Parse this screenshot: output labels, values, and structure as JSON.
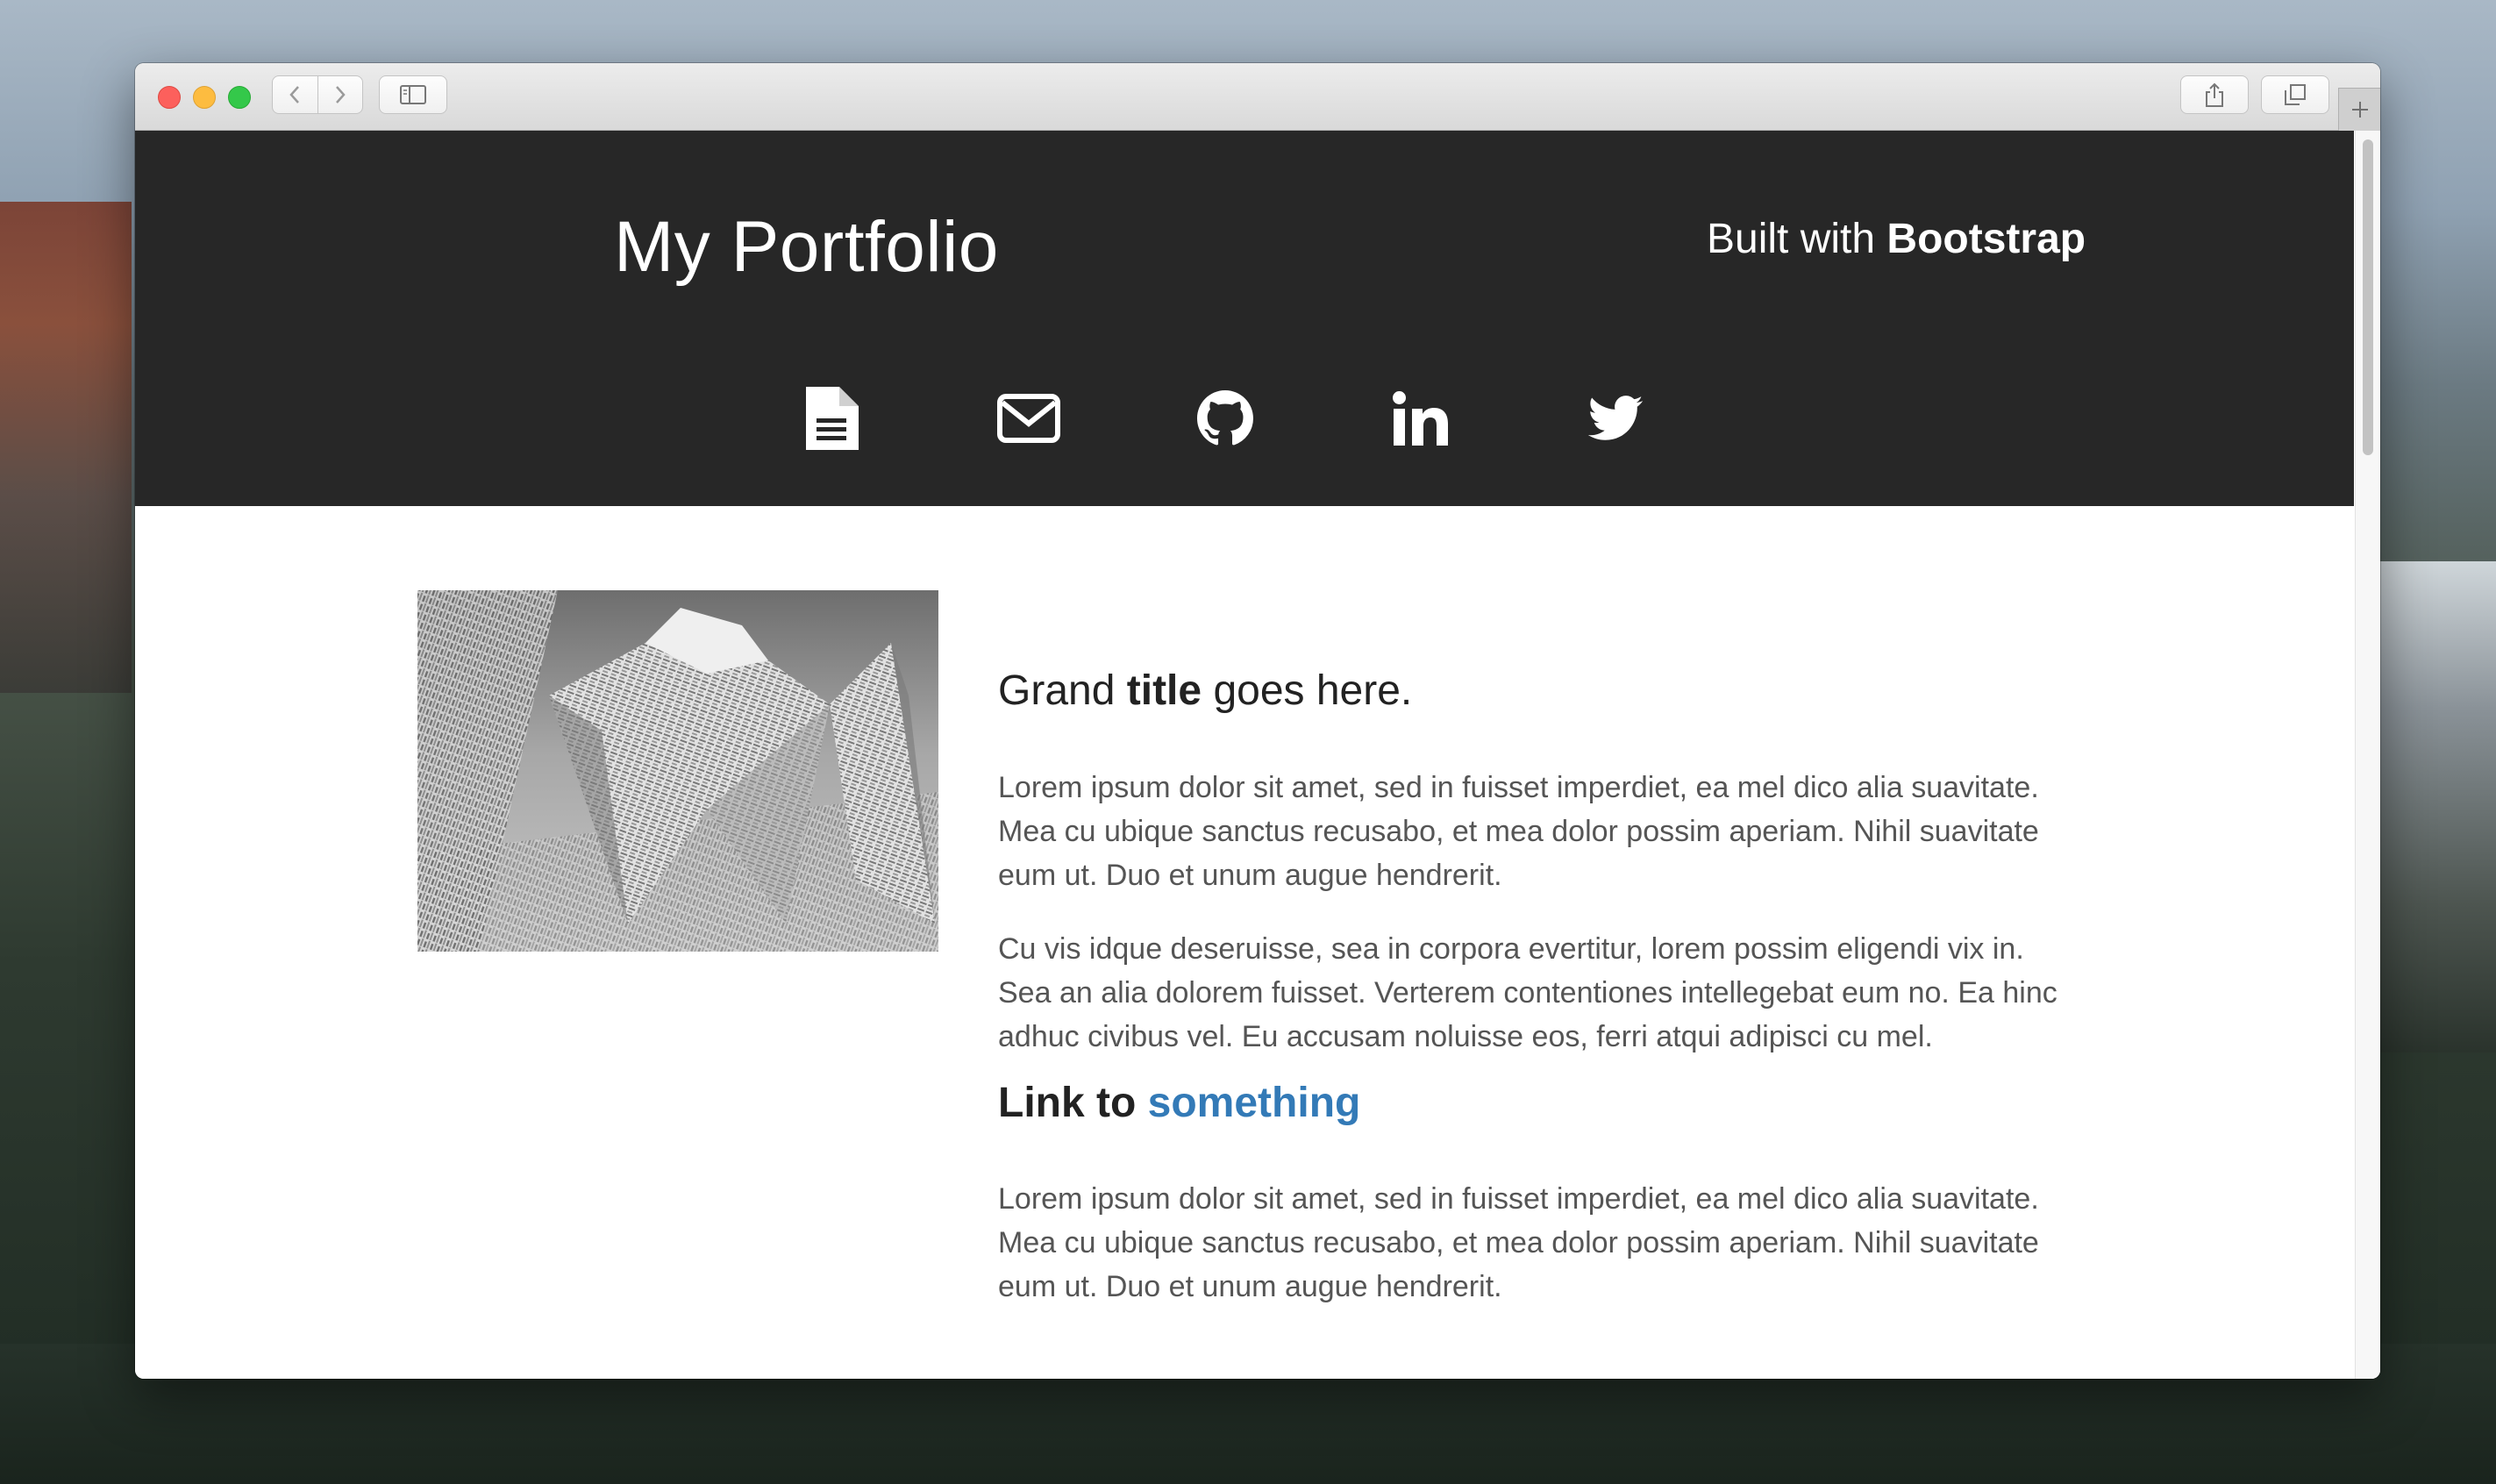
{
  "header": {
    "title": "My Portfolio",
    "built_prefix": "Built with",
    "built_brand": "Bootstrap",
    "social": [
      {
        "icon": "document-icon"
      },
      {
        "icon": "envelope-icon"
      },
      {
        "icon": "github-icon"
      },
      {
        "icon": "linkedin-icon"
      },
      {
        "icon": "twitter-icon"
      }
    ]
  },
  "article": {
    "title_start": "Grand",
    "title_bold": "title",
    "title_end": "goes here.",
    "paragraph1": "Lorem ipsum dolor sit amet, sed in fuisset imperdiet, ea mel dico alia suavitate. Mea cu ubique sanctus recusabo, et mea dolor possim aperiam. Nihil suavitate eum ut. Duo et unum augue hendrerit.",
    "paragraph2": "Cu vis idque deseruisse, sea in corpora evertitur, lorem possim eligendi vix in. Sea an alia dolorem fuisset. Verterem contentiones intellegebat eum no. Ea hinc adhuc civibus vel. Eu accusam noluisse eos, ferri atqui adipisci cu mel.",
    "link_prefix": "Link to",
    "link_text": "something",
    "paragraph3": "Lorem ipsum dolor sit amet, sed in fuisset imperdiet, ea mel dico alia suavitate. Mea cu ubique sanctus recusabo, et mea dolor possim aperiam. Nihil suavitate eum ut. Duo et unum augue hendrerit."
  },
  "colors": {
    "header_bg": "#272727",
    "link": "#337ab7",
    "body_text": "#555555"
  }
}
